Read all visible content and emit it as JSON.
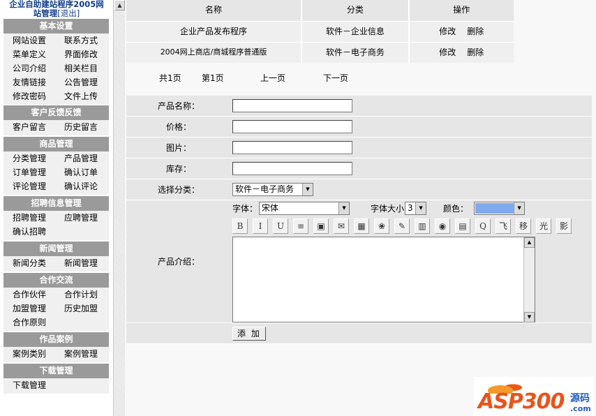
{
  "sidebar": {
    "title_line1": "企业自助建站程序2005网",
    "title_line2": "站管理",
    "logout": "[退出]",
    "sections": [
      {
        "title": "基本设置",
        "items": [
          "网站设置",
          "联系方式",
          "菜单定义",
          "界面修改",
          "公司介绍",
          "相关栏目",
          "友情链接",
          "公告管理",
          "修改密码",
          "文件上传"
        ]
      },
      {
        "title": "客户反馈反馈",
        "items": [
          "客户留言",
          "历史留言"
        ]
      },
      {
        "title": "商品管理",
        "items": [
          "分类管理",
          "产品管理",
          "订单管理",
          "确认订单",
          "评论管理",
          "确认评论"
        ]
      },
      {
        "title": "招聘信息管理",
        "items": [
          "招聘管理",
          "应聘管理",
          "确认招聘"
        ]
      },
      {
        "title": "新闻管理",
        "items": [
          "新闻分类",
          "新闻管理"
        ]
      },
      {
        "title": "合作交流",
        "items": [
          "合作伙伴",
          "合作计划",
          "加盟管理",
          "历史加盟",
          "合作原则"
        ]
      },
      {
        "title": "作品案例",
        "items": [
          "案例类别",
          "案例管理"
        ]
      },
      {
        "title": "下载管理",
        "items": [
          "下载管理"
        ]
      }
    ]
  },
  "table": {
    "headers": [
      "名称",
      "分类",
      "操作"
    ],
    "rows": [
      {
        "name": "企业产品发布程序",
        "category": "软件－企业信息",
        "edit": "修改",
        "delete": "删除"
      },
      {
        "name": "2004网上商店/商城程序普通版",
        "category": "软件－电子商务",
        "edit": "修改",
        "delete": "删除"
      }
    ]
  },
  "pager": {
    "total": "共1页",
    "current": "第1页",
    "prev": "上一页",
    "next": "下一页"
  },
  "form": {
    "name_label": "产品名称：",
    "price_label": "价格：",
    "image_label": "图片：",
    "stock_label": "库存：",
    "category_label": "选择分类：",
    "category_value": "软件－电子商务",
    "intro_label": "产品介绍：",
    "font_label": "字体：",
    "font_value": "宋体",
    "size_label": "字体大小",
    "size_value": "3",
    "color_label": "颜色：",
    "color_value": "#7faaf0",
    "submit_label": "添 加"
  },
  "toolbar": [
    {
      "icon": "bold-icon",
      "glyph": "B"
    },
    {
      "icon": "italic-icon",
      "glyph": "I"
    },
    {
      "icon": "underline-icon",
      "glyph": "U"
    },
    {
      "icon": "align-icon",
      "glyph": "≡"
    },
    {
      "icon": "image-icon",
      "glyph": "▣"
    },
    {
      "icon": "link-icon",
      "glyph": "✉"
    },
    {
      "icon": "table-icon",
      "glyph": "▦"
    },
    {
      "icon": "color-wheel-icon",
      "glyph": "❀"
    },
    {
      "icon": "comment-icon",
      "glyph": "✎"
    },
    {
      "icon": "media-icon",
      "glyph": "▥"
    },
    {
      "icon": "preview-icon",
      "glyph": "◉"
    },
    {
      "icon": "flash-icon",
      "glyph": "▤"
    },
    {
      "icon": "quicktime-icon",
      "glyph": "Q"
    },
    {
      "icon": "fly-text-icon",
      "glyph": "飞"
    },
    {
      "icon": "move-text-icon",
      "glyph": "移"
    },
    {
      "icon": "glow-text-icon",
      "glyph": "光"
    },
    {
      "icon": "shadow-text-icon",
      "glyph": "影"
    }
  ],
  "watermark": {
    "brand": "ASP300",
    "cn": "源码",
    "domain": ".com"
  }
}
